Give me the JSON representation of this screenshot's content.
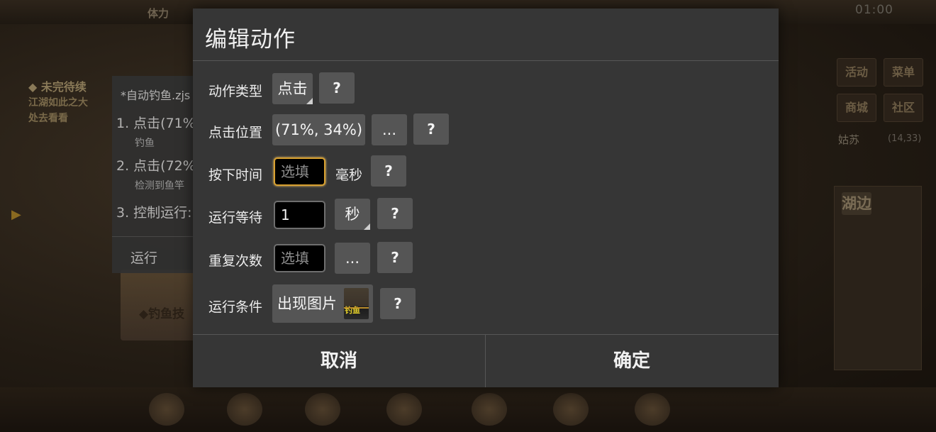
{
  "background": {
    "stat_label": "体力",
    "clock": "01:00",
    "quest_title": "◆ 未完待续",
    "quest_lines": [
      "江湖如此之大",
      "处去看看"
    ],
    "right_buttons": [
      "活动",
      "菜单",
      "商城",
      "社区"
    ],
    "location": "姑苏",
    "location_coords": "(14,33)",
    "panel_button": "湖边",
    "scroll_text": "◆钓鱼技"
  },
  "script_panel": {
    "filename": "*自动钓鱼.zjs",
    "steps": [
      {
        "label": "1. 点击(71%,",
        "sub": "钓鱼"
      },
      {
        "label": "2. 点击(72%",
        "sub": "检测到鱼竿"
      },
      {
        "label": "3. 控制运行:",
        "sub": ""
      }
    ],
    "run_label": "运行"
  },
  "dialog": {
    "title": "编辑动作",
    "rows": {
      "action_type": {
        "label": "动作类型",
        "value": "点击",
        "help": "?"
      },
      "click_pos": {
        "label": "点击位置",
        "value": "(71%, 34%)",
        "more": "...",
        "help": "?"
      },
      "press_time": {
        "label": "按下时间",
        "placeholder": "选填",
        "unit": "毫秒",
        "help": "?"
      },
      "run_wait": {
        "label": "运行等待",
        "value": "1",
        "unit": "秒",
        "help": "?"
      },
      "repeat": {
        "label": "重复次数",
        "placeholder": "选填",
        "more": "...",
        "help": "?"
      },
      "condition": {
        "label": "运行条件",
        "value": "出现图片",
        "thumb_text": "钓鱼",
        "help": "?"
      }
    },
    "cancel": "取消",
    "confirm": "确定"
  }
}
